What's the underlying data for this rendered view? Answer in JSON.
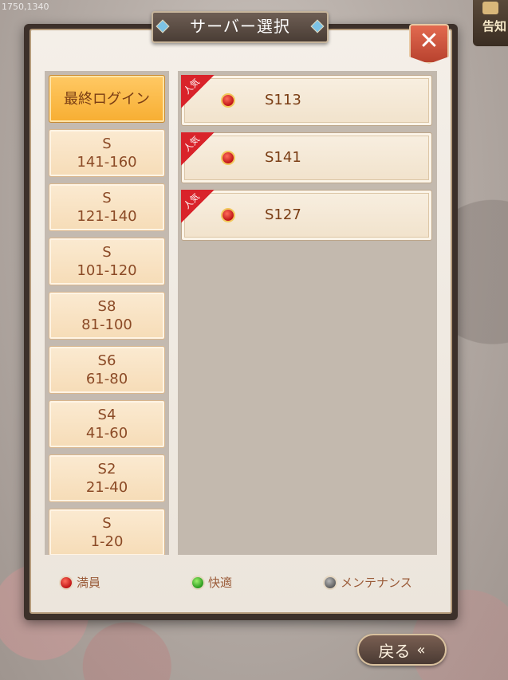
{
  "topbar": {
    "coords": "1750,1340",
    "notice_label": "告知"
  },
  "dialog": {
    "title": "サーバー選択",
    "close_label": "✕"
  },
  "ranges": [
    {
      "line1": "最終ログイン",
      "line2": "",
      "active": true
    },
    {
      "line1": "S",
      "line2": "141-160"
    },
    {
      "line1": "S",
      "line2": "121-140"
    },
    {
      "line1": "S",
      "line2": "101-120"
    },
    {
      "line1": "S8",
      "line2": "81-100"
    },
    {
      "line1": "S6",
      "line2": "61-80"
    },
    {
      "line1": "S4",
      "line2": "41-60"
    },
    {
      "line1": "S2",
      "line2": "21-40"
    },
    {
      "line1": "S",
      "line2": "1-20"
    }
  ],
  "servers": [
    {
      "name": "S113",
      "badge": "人気",
      "status": "満員"
    },
    {
      "name": "S141",
      "badge": "人気",
      "status": "満員"
    },
    {
      "name": "S127",
      "badge": "人気",
      "status": "満員"
    }
  ],
  "legend": [
    {
      "label": "満員",
      "color": "#d11f1f"
    },
    {
      "label": "快適",
      "color": "#2a9a1e"
    },
    {
      "label": "メンテナンス",
      "color": "#5e5e5e"
    }
  ],
  "back_button": {
    "label": "戻る",
    "icon": "back-arrow-icon"
  }
}
